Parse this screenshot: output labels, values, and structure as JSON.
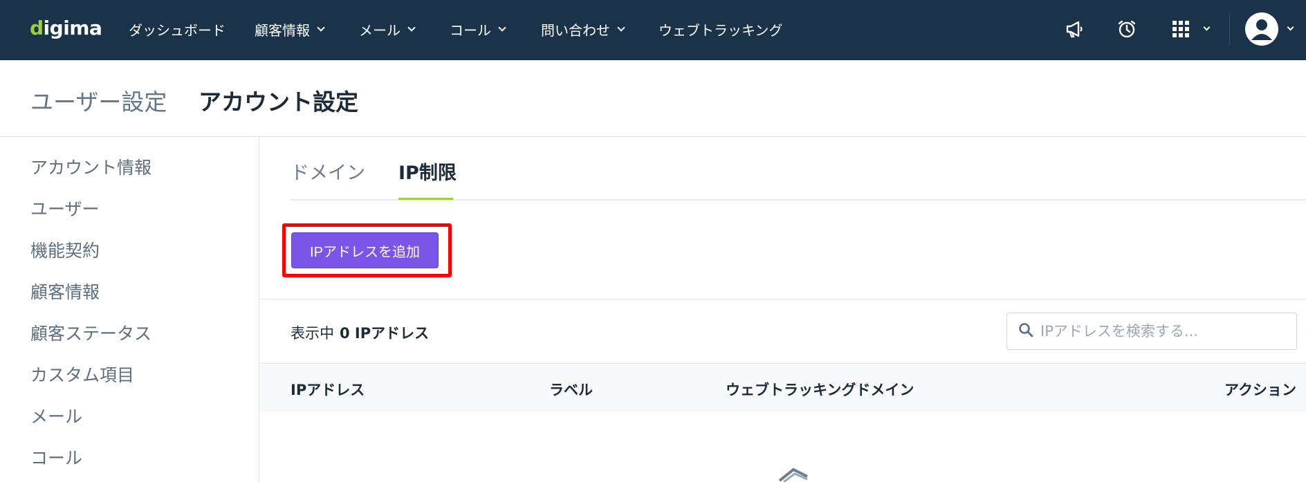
{
  "app": {
    "logo_text": "digima"
  },
  "topnav": {
    "items": [
      {
        "label": "ダッシュボード"
      },
      {
        "label": "顧客情報"
      },
      {
        "label": "メール"
      },
      {
        "label": "コール"
      },
      {
        "label": "問い合わせ"
      },
      {
        "label": "ウェブトラッキング"
      }
    ],
    "icons": [
      "megaphone-icon",
      "alarm-clock-icon",
      "apps-grid-icon",
      "user-avatar-icon"
    ]
  },
  "header": {
    "breadcrumb_parent": "ユーザー設定",
    "title": "アカウント設定"
  },
  "sidebar": {
    "items": [
      {
        "label": "アカウント情報"
      },
      {
        "label": "ユーザー"
      },
      {
        "label": "機能契約"
      },
      {
        "label": "顧客情報"
      },
      {
        "label": "顧客ステータス"
      },
      {
        "label": "カスタム項目"
      },
      {
        "label": "メール"
      },
      {
        "label": "コール"
      }
    ]
  },
  "tabs": [
    {
      "label": "ドメイン",
      "active": false
    },
    {
      "label": "IP制限",
      "active": true
    }
  ],
  "actions": {
    "add_button_label": "IPアドレスを追加"
  },
  "listing": {
    "showing_label": "表示中",
    "count_label": "0 IPアドレス",
    "search_placeholder": "IPアドレスを検索する..."
  },
  "table": {
    "columns": [
      "IPアドレス",
      "ラベル",
      "ウェブトラッキングドメイン",
      "アクション"
    ],
    "rows": []
  },
  "colors": {
    "nav_bg": "#1b3349",
    "accent_green": "#9fd03c",
    "primary_button": "#7b55ea",
    "highlight": "#ff0000"
  }
}
